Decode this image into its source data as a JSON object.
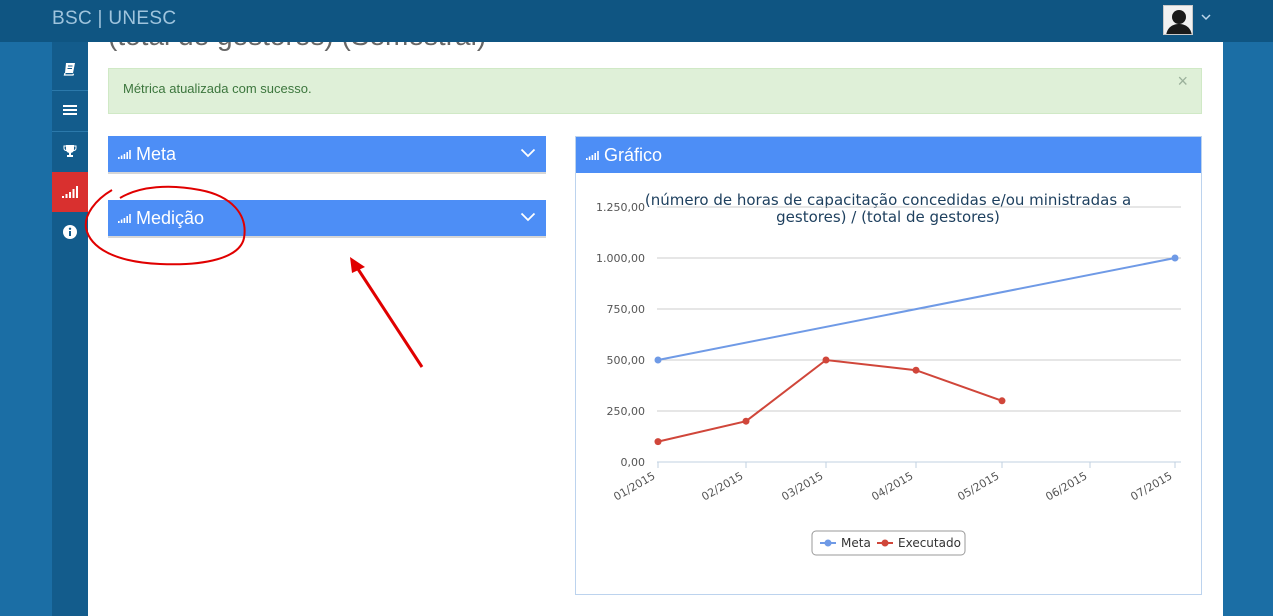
{
  "brand": "BSC | UNESC",
  "page_title": "(total de gestores) (Semestral)",
  "alert": {
    "message": "Métrica atualizada com sucesso.",
    "close": "×"
  },
  "panels": {
    "meta": {
      "title": "Meta"
    },
    "medicao": {
      "title": "Medição"
    },
    "grafico": {
      "title": "Gráfico"
    }
  },
  "sidebar": {
    "items": [
      {
        "icon": "book-icon"
      },
      {
        "icon": "list-icon"
      },
      {
        "icon": "trophy-icon"
      },
      {
        "icon": "signal-icon",
        "active": true
      },
      {
        "icon": "info-icon"
      }
    ]
  },
  "colors": {
    "accent": "#4d8ef6",
    "active_sidebar": "#d9302f",
    "meta_series": "#6f9ae6",
    "executado_series": "#d0463a",
    "annotation": "#e00000"
  },
  "chart_data": {
    "type": "line",
    "title": "(número de horas de capacitação concedidas e/ou ministradas a gestores) / (total de gestores)",
    "title_lines": [
      "(número de horas de capacitação concedidas e/ou ministradas a",
      "gestores) / (total de gestores)"
    ],
    "categories": [
      "01/2015",
      "02/2015",
      "03/2015",
      "04/2015",
      "05/2015",
      "06/2015",
      "07/2015"
    ],
    "yticks": [
      "0,00",
      "250,00",
      "500,00",
      "750,00",
      "1.000,00",
      "1.250,00"
    ],
    "ylim": [
      0,
      1250
    ],
    "grid": true,
    "legend_position": "bottom",
    "series": [
      {
        "name": "Meta",
        "points": [
          [
            0,
            500
          ],
          [
            6,
            1000
          ]
        ]
      },
      {
        "name": "Executado",
        "points": [
          [
            0,
            100
          ],
          [
            1,
            200
          ],
          [
            2,
            500
          ],
          [
            3,
            450
          ],
          [
            4,
            300
          ]
        ]
      }
    ]
  }
}
